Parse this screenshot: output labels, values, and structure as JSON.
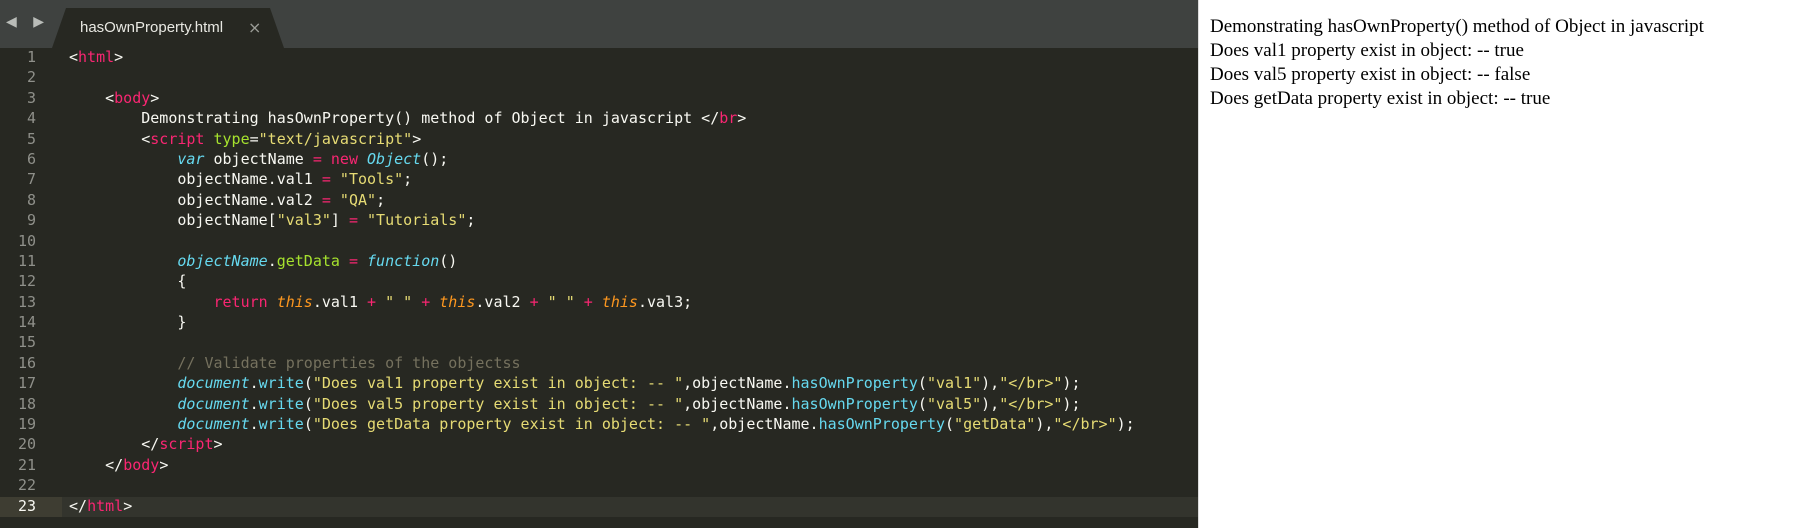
{
  "editor": {
    "nav_glyph": "◀ ▶",
    "tab_title": "hasOwnProperty.html",
    "tab_close": "×",
    "lines": [
      {
        "n": "1"
      },
      {
        "n": "2"
      },
      {
        "n": "3"
      },
      {
        "n": "4"
      },
      {
        "n": "5"
      },
      {
        "n": "6"
      },
      {
        "n": "7"
      },
      {
        "n": "8"
      },
      {
        "n": "9"
      },
      {
        "n": "10"
      },
      {
        "n": "11"
      },
      {
        "n": "12"
      },
      {
        "n": "13"
      },
      {
        "n": "14"
      },
      {
        "n": "15"
      },
      {
        "n": "16"
      },
      {
        "n": "17"
      },
      {
        "n": "18"
      },
      {
        "n": "19"
      },
      {
        "n": "20"
      },
      {
        "n": "21"
      },
      {
        "n": "22"
      },
      {
        "n": "23"
      }
    ],
    "code": {
      "l1_open": "<",
      "l1_tag": "html",
      "l1_close": ">",
      "l3_open": "<",
      "l3_tag": "body",
      "l3_close": ">",
      "l4_text": "Demonstrating hasOwnProperty() method of Object in javascript </",
      "l4_tag": "br",
      "l4_close": ">",
      "l5_open": "<",
      "l5_tag": "script",
      "l5_attr": "type",
      "l5_eq": "=",
      "l5_val": "\"text/javascript\"",
      "l5_close": ">",
      "l6_var": "var",
      "l6_name": " objectName ",
      "l6_eq": "=",
      "l6_new": " new ",
      "l6_obj": "Object",
      "l6_end": "();",
      "l7_a": "objectName.val1 ",
      "l7_eq": "=",
      "l7_s": " \"Tools\"",
      "l7_end": ";",
      "l8_a": "objectName.val2 ",
      "l8_eq": "=",
      "l8_s": " \"QA\"",
      "l8_end": ";",
      "l9_a": "objectName[",
      "l9_s": "\"val3\"",
      "l9_b": "] ",
      "l9_eq": "=",
      "l9_s2": " \"Tutorials\"",
      "l9_end": ";",
      "l11_obj": "objectName",
      "l11_dot": ".",
      "l11_m": "getData",
      "l11_eq": " = ",
      "l11_fn": "function",
      "l11_end": "()",
      "l12": "{",
      "l13_ret": "return ",
      "l13_this1": "this",
      "l13_p1": ".val1 ",
      "l13_op1": "+",
      "l13_s1": " \" \" ",
      "l13_op2": "+",
      "l13_this2": " this",
      "l13_p2": ".val2 ",
      "l13_op3": "+",
      "l13_s2": " \" \" ",
      "l13_op4": "+",
      "l13_this3": " this",
      "l13_p3": ".val3;",
      "l14": "}",
      "l16": "// Validate properties of the objectss",
      "w_doc": "document",
      "w_dot": ".",
      "w_write": "write",
      "w_open": "(",
      "l17_s": "\"Does val1 property exist in object: -- \"",
      "w_mid": ",objectName.",
      "w_has": "hasOwnProperty",
      "l17_arg": "\"val1\"",
      "w_close": "),",
      "l18_s": "\"Does val5 property exist in object: -- \"",
      "l18_arg": "\"val5\"",
      "l19_s": "\"Does getData property exist in object: -- \"",
      "l19_arg": "\"getData\"",
      "w_br": "\"</br>\"",
      "w_end": ");",
      "l20_open": "</",
      "l20_tag": "script",
      "l20_close": ">",
      "l21_open": "</",
      "l21_tag": "body",
      "l21_close": ">",
      "l23_open": "</",
      "l23_tag": "html",
      "l23_close": ">"
    }
  },
  "output": {
    "lines": [
      "Demonstrating hasOwnProperty() method of Object in javascript",
      "Does val1 property exist in object: -- true",
      "Does val5 property exist in object: -- false",
      "Does getData property exist in object: -- true"
    ]
  }
}
